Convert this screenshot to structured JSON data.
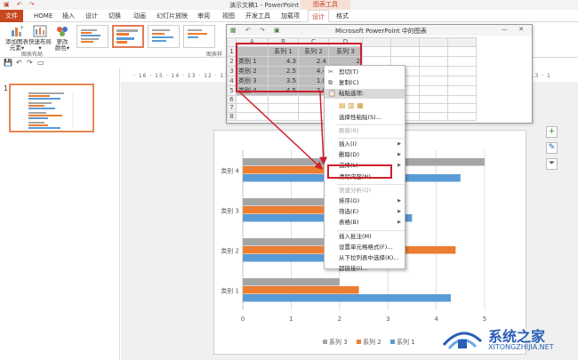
{
  "window": {
    "doc_title": "演示文稿1 - PowerPoint",
    "context_tab": "图表工具"
  },
  "ribbon_tabs": [
    {
      "label": "文件",
      "kind": "file"
    },
    {
      "label": "HOME"
    },
    {
      "label": "插入"
    },
    {
      "label": "设计"
    },
    {
      "label": "切换"
    },
    {
      "label": "动画"
    },
    {
      "label": "幻灯片放映"
    },
    {
      "label": "审阅"
    },
    {
      "label": "视图"
    },
    {
      "label": "开发工具"
    },
    {
      "label": "加载项"
    },
    {
      "label": "设计",
      "kind": "active"
    },
    {
      "label": "格式"
    }
  ],
  "ribbon": {
    "add_element": "添加图表\n元素▾",
    "quick_layout": "快速布局\n▾",
    "change_color": "更改\n颜色▾",
    "group_chart_layout": "图表布局",
    "group_chart_styles": "图表样"
  },
  "colors": {
    "accent": "#c7471f",
    "series1": "#5b9bd5",
    "series2": "#ed7d31",
    "series3": "#a5a5a5",
    "highlight": "#d01f2b"
  },
  "sheet": {
    "title": "Microsoft PowerPoint 中的图表",
    "col_headers": [
      "",
      "A",
      "B",
      "C",
      "D"
    ],
    "header_row": [
      "",
      "系列 1",
      "系列 2",
      "系列 3"
    ],
    "rows": [
      {
        "n": "1",
        "cells": [
          "",
          "系列 1",
          "系列 2",
          "系列 3"
        ]
      },
      {
        "n": "2",
        "cells": [
          "类别 1",
          "4.3",
          "2.4",
          "2"
        ]
      },
      {
        "n": "3",
        "cells": [
          "类别 2",
          "2.5",
          "4.4",
          "2"
        ]
      },
      {
        "n": "4",
        "cells": [
          "类别 3",
          "3.5",
          "1.8",
          "3"
        ]
      },
      {
        "n": "5",
        "cells": [
          "类别 4",
          "4.5",
          "2.8",
          "5"
        ]
      },
      {
        "n": "6",
        "cells": [
          "",
          "",
          "",
          ""
        ]
      },
      {
        "n": "7",
        "cells": [
          "",
          "",
          "",
          ""
        ]
      },
      {
        "n": "8",
        "cells": [
          "",
          "",
          "",
          ""
        ]
      }
    ]
  },
  "context_menu": [
    {
      "label": "剪切(T)",
      "icon": "scissors-icon"
    },
    {
      "label": "复制(C)",
      "icon": "copy-icon"
    },
    {
      "label": "粘贴选项:",
      "icon": "paste-icon",
      "highlight": true
    },
    {
      "label": "选择性粘贴(S)..."
    },
    {
      "label": "刷新(R)",
      "disabled": true
    },
    {
      "label": "插入(I)",
      "arrow": true
    },
    {
      "label": "删除(D)",
      "arrow": true
    },
    {
      "label": "选择(L)",
      "arrow": true
    },
    {
      "label": "清除内容(N)"
    },
    {
      "label": "快速分析(Q)",
      "disabled": true
    },
    {
      "label": "排序(O)",
      "arrow": true
    },
    {
      "label": "筛选(E)",
      "arrow": true
    },
    {
      "label": "表格(B)",
      "arrow": true
    },
    {
      "label": "插入批注(M)"
    },
    {
      "label": "设置单元格格式(F)..."
    },
    {
      "label": "从下拉列表中选择(K)..."
    },
    {
      "label": "超链接(I)..."
    }
  ],
  "chart_data": {
    "type": "bar",
    "orientation": "horizontal",
    "categories": [
      "类别 1",
      "类别 2",
      "类别 3",
      "类别 4"
    ],
    "series": [
      {
        "name": "系列 1",
        "values": [
          4.3,
          2.5,
          3.5,
          4.5
        ]
      },
      {
        "name": "系列 2",
        "values": [
          2.4,
          4.4,
          1.8,
          2.8
        ]
      },
      {
        "name": "系列 3",
        "values": [
          2,
          2,
          3,
          5
        ]
      }
    ],
    "xlim": [
      0,
      5
    ],
    "xticks": [
      "0",
      "1",
      "2",
      "3",
      "4",
      "5"
    ],
    "legend": "bottom",
    "grid": true
  },
  "slide_panel": {
    "number": "1"
  },
  "ruler": "· 16 · 15 · 14 · 13 · 12 · 11 · 10 · 9 · 8 · 7 · 6 · 5 · 4 · 3 · 2 · 1 · 0 · 1 · 2 · 3 · 4 · 5 · 6 · 7 · 8 · 9 · 10 · 11 · 12 · 13 · 14 · 15 · 16",
  "watermark": {
    "name": "系统之家",
    "url": "XITONGZHIJIA.NET"
  }
}
